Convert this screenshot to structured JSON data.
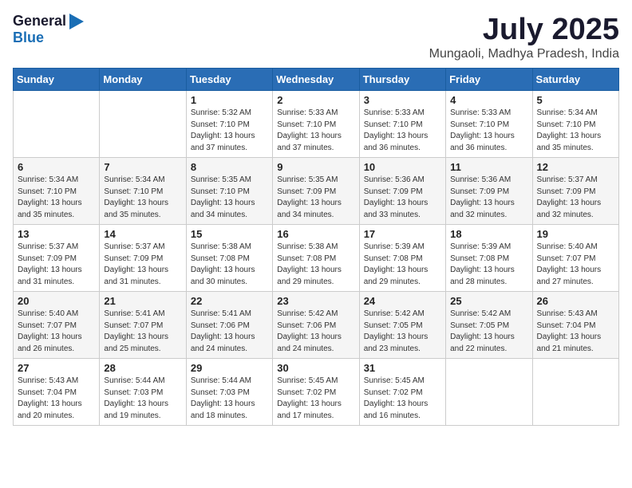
{
  "logo": {
    "general": "General",
    "blue": "Blue"
  },
  "title": {
    "month": "July 2025",
    "location": "Mungaoli, Madhya Pradesh, India"
  },
  "headers": [
    "Sunday",
    "Monday",
    "Tuesday",
    "Wednesday",
    "Thursday",
    "Friday",
    "Saturday"
  ],
  "weeks": [
    [
      {
        "day": "",
        "info": ""
      },
      {
        "day": "",
        "info": ""
      },
      {
        "day": "1",
        "info": "Sunrise: 5:32 AM\nSunset: 7:10 PM\nDaylight: 13 hours and 37 minutes."
      },
      {
        "day": "2",
        "info": "Sunrise: 5:33 AM\nSunset: 7:10 PM\nDaylight: 13 hours and 37 minutes."
      },
      {
        "day": "3",
        "info": "Sunrise: 5:33 AM\nSunset: 7:10 PM\nDaylight: 13 hours and 36 minutes."
      },
      {
        "day": "4",
        "info": "Sunrise: 5:33 AM\nSunset: 7:10 PM\nDaylight: 13 hours and 36 minutes."
      },
      {
        "day": "5",
        "info": "Sunrise: 5:34 AM\nSunset: 7:10 PM\nDaylight: 13 hours and 35 minutes."
      }
    ],
    [
      {
        "day": "6",
        "info": "Sunrise: 5:34 AM\nSunset: 7:10 PM\nDaylight: 13 hours and 35 minutes."
      },
      {
        "day": "7",
        "info": "Sunrise: 5:34 AM\nSunset: 7:10 PM\nDaylight: 13 hours and 35 minutes."
      },
      {
        "day": "8",
        "info": "Sunrise: 5:35 AM\nSunset: 7:10 PM\nDaylight: 13 hours and 34 minutes."
      },
      {
        "day": "9",
        "info": "Sunrise: 5:35 AM\nSunset: 7:09 PM\nDaylight: 13 hours and 34 minutes."
      },
      {
        "day": "10",
        "info": "Sunrise: 5:36 AM\nSunset: 7:09 PM\nDaylight: 13 hours and 33 minutes."
      },
      {
        "day": "11",
        "info": "Sunrise: 5:36 AM\nSunset: 7:09 PM\nDaylight: 13 hours and 32 minutes."
      },
      {
        "day": "12",
        "info": "Sunrise: 5:37 AM\nSunset: 7:09 PM\nDaylight: 13 hours and 32 minutes."
      }
    ],
    [
      {
        "day": "13",
        "info": "Sunrise: 5:37 AM\nSunset: 7:09 PM\nDaylight: 13 hours and 31 minutes."
      },
      {
        "day": "14",
        "info": "Sunrise: 5:37 AM\nSunset: 7:09 PM\nDaylight: 13 hours and 31 minutes."
      },
      {
        "day": "15",
        "info": "Sunrise: 5:38 AM\nSunset: 7:08 PM\nDaylight: 13 hours and 30 minutes."
      },
      {
        "day": "16",
        "info": "Sunrise: 5:38 AM\nSunset: 7:08 PM\nDaylight: 13 hours and 29 minutes."
      },
      {
        "day": "17",
        "info": "Sunrise: 5:39 AM\nSunset: 7:08 PM\nDaylight: 13 hours and 29 minutes."
      },
      {
        "day": "18",
        "info": "Sunrise: 5:39 AM\nSunset: 7:08 PM\nDaylight: 13 hours and 28 minutes."
      },
      {
        "day": "19",
        "info": "Sunrise: 5:40 AM\nSunset: 7:07 PM\nDaylight: 13 hours and 27 minutes."
      }
    ],
    [
      {
        "day": "20",
        "info": "Sunrise: 5:40 AM\nSunset: 7:07 PM\nDaylight: 13 hours and 26 minutes."
      },
      {
        "day": "21",
        "info": "Sunrise: 5:41 AM\nSunset: 7:07 PM\nDaylight: 13 hours and 25 minutes."
      },
      {
        "day": "22",
        "info": "Sunrise: 5:41 AM\nSunset: 7:06 PM\nDaylight: 13 hours and 24 minutes."
      },
      {
        "day": "23",
        "info": "Sunrise: 5:42 AM\nSunset: 7:06 PM\nDaylight: 13 hours and 24 minutes."
      },
      {
        "day": "24",
        "info": "Sunrise: 5:42 AM\nSunset: 7:05 PM\nDaylight: 13 hours and 23 minutes."
      },
      {
        "day": "25",
        "info": "Sunrise: 5:42 AM\nSunset: 7:05 PM\nDaylight: 13 hours and 22 minutes."
      },
      {
        "day": "26",
        "info": "Sunrise: 5:43 AM\nSunset: 7:04 PM\nDaylight: 13 hours and 21 minutes."
      }
    ],
    [
      {
        "day": "27",
        "info": "Sunrise: 5:43 AM\nSunset: 7:04 PM\nDaylight: 13 hours and 20 minutes."
      },
      {
        "day": "28",
        "info": "Sunrise: 5:44 AM\nSunset: 7:03 PM\nDaylight: 13 hours and 19 minutes."
      },
      {
        "day": "29",
        "info": "Sunrise: 5:44 AM\nSunset: 7:03 PM\nDaylight: 13 hours and 18 minutes."
      },
      {
        "day": "30",
        "info": "Sunrise: 5:45 AM\nSunset: 7:02 PM\nDaylight: 13 hours and 17 minutes."
      },
      {
        "day": "31",
        "info": "Sunrise: 5:45 AM\nSunset: 7:02 PM\nDaylight: 13 hours and 16 minutes."
      },
      {
        "day": "",
        "info": ""
      },
      {
        "day": "",
        "info": ""
      }
    ]
  ]
}
